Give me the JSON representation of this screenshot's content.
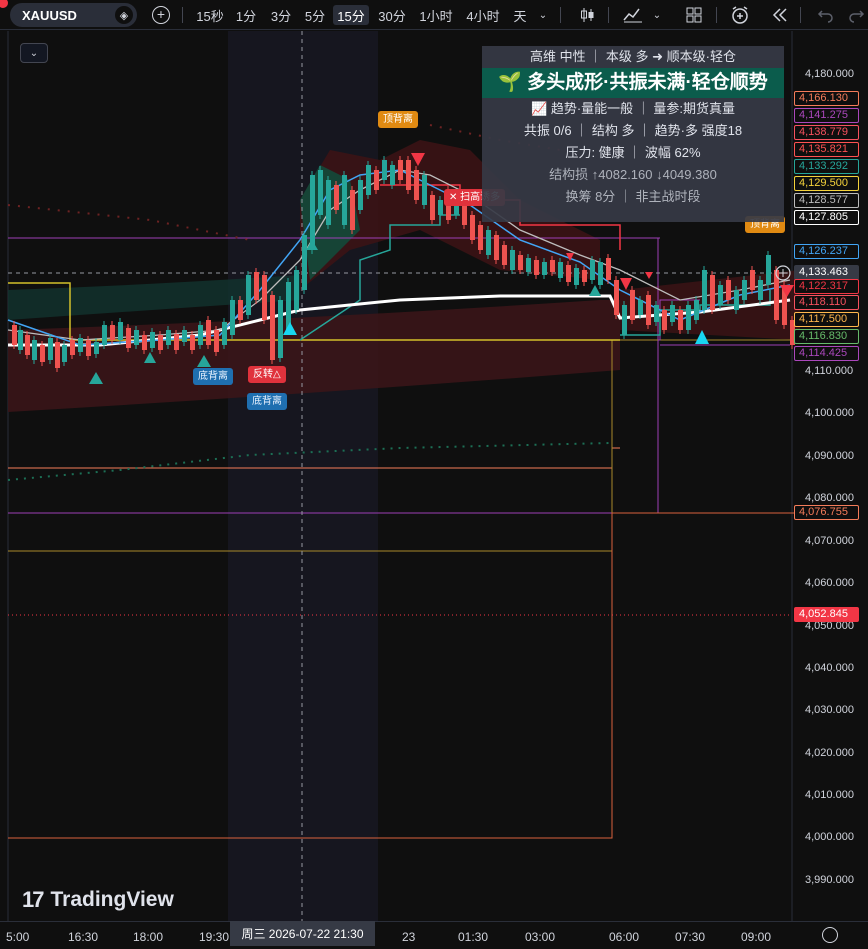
{
  "toolbar": {
    "symbol": "XAUUSD",
    "intervals": [
      "15秒",
      "1分",
      "3分",
      "5分",
      "15分",
      "30分",
      "1小时",
      "4小时",
      "天"
    ],
    "active_interval": "15分",
    "icons": [
      "diamond-icon",
      "add-symbol-icon",
      "interval-dropdown-icon",
      "candle-type-icon",
      "indicators-icon",
      "layouts-icon",
      "alert-icon",
      "replay-icon",
      "undo-icon",
      "redo-icon"
    ]
  },
  "info_panel": {
    "line1": "高维 中性 ｜ 本级 多 ➜ 顺本级·轻仓",
    "headline": "🌱 多头成形·共振未满·轻仓顺势",
    "line3": "📈 趋势·量能一般 ｜ 量参:期货真量",
    "line4": "共振 0/6 ｜ 结构 多 ｜ 趋势·多 强度18",
    "line5": "压力: 健康 ｜ 波幅 62%",
    "line6": "结构损 ↑4082.160 ↓4049.380",
    "line7": "换筹 8分 ｜ 非主战时段"
  },
  "markers": {
    "top_divergence_1": "顶背离",
    "top_divergence_2": "顶背离",
    "bottom_divergence_1": "底背离",
    "bottom_divergence_2": "底背离",
    "reversal": "反转△",
    "sweep": "✕ 扫高诱多"
  },
  "price_axis": {
    "labels": [
      "4,180.000",
      "4,110.000",
      "4,100.000",
      "4,090.000",
      "4,080.000",
      "4,070.000",
      "4,060.000",
      "4,050.000",
      "4,040.000",
      "4,030.000",
      "4,020.000",
      "4,010.000",
      "4,000.000",
      "3,990.000"
    ],
    "tags": [
      {
        "value": "4,166.130",
        "color": "#f57c5a"
      },
      {
        "value": "4,141.275",
        "color": "#ab47bc"
      },
      {
        "value": "4,138.779",
        "color": "#f7525f"
      },
      {
        "value": "4,135.821",
        "color": "#ff5252"
      },
      {
        "value": "4,133.292",
        "color": "#26a69a"
      },
      {
        "value": "4,129.500",
        "color": "#f5d33b"
      },
      {
        "value": "4,128.577",
        "color": "#bdbdbd"
      },
      {
        "value": "4,127.805",
        "color": "#ffffff"
      },
      {
        "value": "4,126.237",
        "color": "#42a5f5"
      },
      {
        "value": "4,133.463",
        "color": "#9598a1"
      },
      {
        "value": "4,122.317",
        "color": "#f23645"
      },
      {
        "value": "4,118.110",
        "color": "#f7525f"
      },
      {
        "value": "4,117.500",
        "color": "#ffb74d"
      },
      {
        "value": "4,116.830",
        "color": "#66bb6a"
      },
      {
        "value": "4,114.425",
        "color": "#ab47bc"
      },
      {
        "value": "4,076.755",
        "color": "#f57c5a"
      },
      {
        "value": "4,052.845",
        "color": "#f23645"
      }
    ]
  },
  "time_axis": {
    "labels": [
      "5:00",
      "16:30",
      "18:00",
      "19:30",
      "23",
      "01:30",
      "03:00",
      "06:00",
      "07:30",
      "09:00"
    ],
    "crosshair": "周三 2026-07-22  21:30"
  },
  "logo": "TradingView",
  "colors": {
    "bull": "#26a69a",
    "bear": "#ef5350",
    "background": "#0f0f0f",
    "panel_green": "#0b5c4c"
  }
}
